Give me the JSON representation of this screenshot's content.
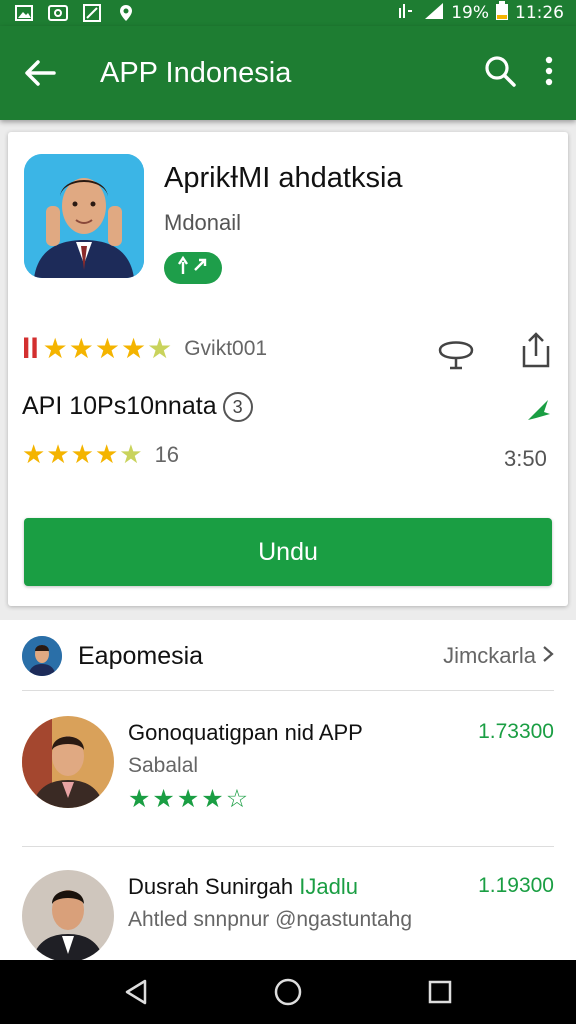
{
  "status_bar": {
    "battery": "19%",
    "time": "11:26",
    "notification_icons": [
      "image-icon",
      "gallery-icon",
      "tool-icon",
      "location-icon"
    ]
  },
  "app_bar": {
    "title": "APP Indonesia",
    "back_icon": "arrow-back-icon",
    "search_icon": "search-icon",
    "menu_icon": "more-vert-icon"
  },
  "app": {
    "name": "AprikƗMI ahdatksia",
    "developer": "Mdonail",
    "badge_icon": "editor-choice-icon",
    "rating_prefix": "II",
    "rating_stars": 4.5,
    "reviews_label": "Gvikt001",
    "info_title": "API 10Ps10nnata",
    "info_badge": "3",
    "secondary_rating_stars": 4.5,
    "secondary_count": "16",
    "secondary_value": "3:50",
    "install_label": "Undu"
  },
  "similar": {
    "title": "Eapomesia",
    "more_label": "Jimckarla",
    "items": [
      {
        "title": "Gonoquatigpan nid APP",
        "subtitle": "Sabalal",
        "price": "1.73300",
        "stars": 3.5
      },
      {
        "title": "Dusrah Sunirgah",
        "title_highlight": "IJadlu",
        "subtitle": "Ahtled snnpnur @ngastuntahg",
        "price": "1.19300"
      }
    ]
  },
  "nav_bar": {
    "back_icon": "nav-back-icon",
    "home_icon": "nav-home-icon",
    "recents_icon": "nav-recents-icon"
  },
  "colors": {
    "primary": "#1e7d32",
    "install": "#1a9e43",
    "star": "#f4b400",
    "accent_red": "#d32f2f"
  }
}
